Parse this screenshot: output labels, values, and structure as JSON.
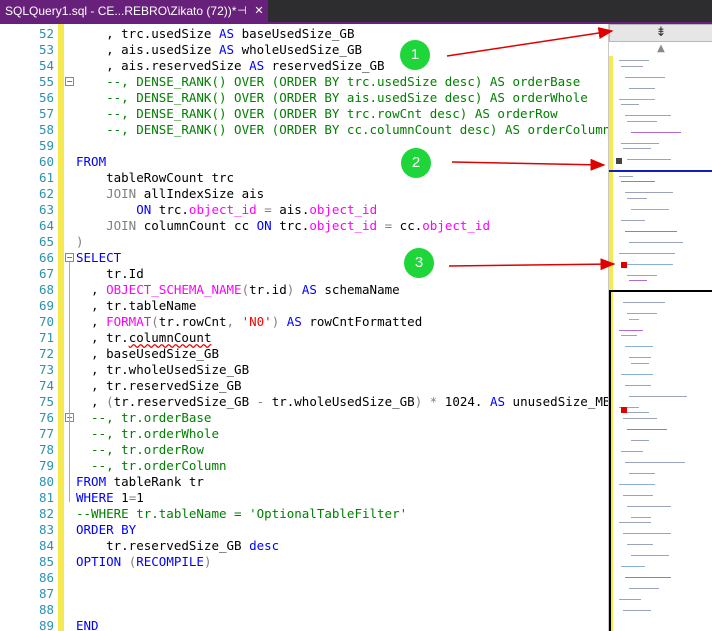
{
  "tab": {
    "title": "SQLQuery1.sql - CE...REBRO\\Zikato (72))*",
    "pin": "⊣",
    "close": "✕"
  },
  "scrollbar": {
    "split_glyph": "⇟",
    "up_glyph": "▲"
  },
  "annotations": [
    "1",
    "2",
    "3"
  ],
  "colors": {
    "tab": "#68217a",
    "keyword": "#0000ff",
    "function": "#ff00ff",
    "string": "#ff0000",
    "comment": "#008000",
    "changed_line": "#f5e94f",
    "marker": "#e00000"
  },
  "lines": [
    {
      "n": "52",
      "t": [
        [
          "",
          "    , trc.usedSize "
        ],
        [
          "kw",
          "AS"
        ],
        [
          "",
          " baseUsedSize_GB"
        ]
      ]
    },
    {
      "n": "53",
      "t": [
        [
          "",
          "    , ais.usedSize "
        ],
        [
          "kw",
          "AS"
        ],
        [
          "",
          " wholeUsedSize_GB"
        ]
      ]
    },
    {
      "n": "54",
      "t": [
        [
          "",
          "    , ais.reservedSize "
        ],
        [
          "kw",
          "AS"
        ],
        [
          "",
          " reservedSize_GB"
        ]
      ]
    },
    {
      "n": "55",
      "fold": true,
      "t": [
        [
          "cm",
          "    --, DENSE_RANK() OVER (ORDER BY trc.usedSize desc) AS orderBase"
        ]
      ]
    },
    {
      "n": "56",
      "t": [
        [
          "cm",
          "    --, DENSE_RANK() OVER (ORDER BY ais.usedSize desc) AS orderWhole"
        ]
      ]
    },
    {
      "n": "57",
      "t": [
        [
          "cm",
          "    --, DENSE_RANK() OVER (ORDER BY trc.rowCnt desc) AS orderRow"
        ]
      ]
    },
    {
      "n": "58",
      "t": [
        [
          "cm",
          "    --, DENSE_RANK() OVER (ORDER BY cc.columnCount desc) AS orderColumn"
        ]
      ]
    },
    {
      "n": "59",
      "t": []
    },
    {
      "n": "60",
      "t": [
        [
          "kw",
          "FROM"
        ]
      ]
    },
    {
      "n": "61",
      "t": [
        [
          "",
          "    tableRowCount trc"
        ]
      ]
    },
    {
      "n": "62",
      "t": [
        [
          "gr",
          "    "
        ],
        [
          "gr",
          "JOIN"
        ],
        [
          "",
          " allIndexSize ais"
        ]
      ]
    },
    {
      "n": "63",
      "t": [
        [
          "",
          "        "
        ],
        [
          "kw",
          "ON"
        ],
        [
          "",
          " trc."
        ],
        [
          "fn",
          "object_id"
        ],
        [
          "",
          " "
        ],
        [
          "gr",
          "="
        ],
        [
          "",
          " ais."
        ],
        [
          "fn",
          "object_id"
        ]
      ]
    },
    {
      "n": "64",
      "t": [
        [
          "",
          "    "
        ],
        [
          "gr",
          "JOIN"
        ],
        [
          "",
          " columnCount cc "
        ],
        [
          "kw",
          "ON"
        ],
        [
          "",
          " trc."
        ],
        [
          "fn",
          "object_id"
        ],
        [
          "",
          " "
        ],
        [
          "gr",
          "="
        ],
        [
          "",
          " cc."
        ],
        [
          "fn",
          "object_id"
        ]
      ]
    },
    {
      "n": "65",
      "t": [
        [
          "gr",
          ")"
        ]
      ]
    },
    {
      "n": "66",
      "fold": true,
      "t": [
        [
          "kw",
          "SELECT"
        ]
      ]
    },
    {
      "n": "67",
      "t": [
        [
          "",
          "    tr.Id"
        ]
      ]
    },
    {
      "n": "68",
      "t": [
        [
          "",
          "  , "
        ],
        [
          "fn",
          "OBJECT_SCHEMA_NAME"
        ],
        [
          "gr",
          "("
        ],
        [
          "",
          "tr.id"
        ],
        [
          "gr",
          ")"
        ],
        [
          "",
          " "
        ],
        [
          "kw",
          "AS"
        ],
        [
          "",
          " schemaName"
        ]
      ]
    },
    {
      "n": "69",
      "t": [
        [
          "",
          "  , tr.tableName"
        ]
      ]
    },
    {
      "n": "70",
      "t": [
        [
          "",
          "  , "
        ],
        [
          "fn",
          "FORMAT"
        ],
        [
          "gr",
          "("
        ],
        [
          "",
          "tr.rowCnt"
        ],
        [
          "gr",
          ","
        ],
        [
          "",
          " "
        ],
        [
          "str",
          "'N0'"
        ],
        [
          "gr",
          ")"
        ],
        [
          "",
          " "
        ],
        [
          "kw",
          "AS"
        ],
        [
          "",
          " rowCntFormatted"
        ]
      ]
    },
    {
      "n": "71",
      "t": [
        [
          "",
          "  , tr."
        ],
        [
          "sq",
          "columnCount"
        ]
      ]
    },
    {
      "n": "72",
      "t": [
        [
          "",
          "  , baseUsedSize_GB"
        ]
      ]
    },
    {
      "n": "73",
      "t": [
        [
          "",
          "  , tr.wholeUsedSize_GB"
        ]
      ]
    },
    {
      "n": "74",
      "t": [
        [
          "",
          "  , tr.reservedSize_GB"
        ]
      ]
    },
    {
      "n": "75",
      "t": [
        [
          "",
          "  , "
        ],
        [
          "gr",
          "("
        ],
        [
          "",
          "tr.reservedSize_GB "
        ],
        [
          "gr",
          "-"
        ],
        [
          "",
          " tr.wholeUsedSize_GB"
        ],
        [
          "gr",
          ")"
        ],
        [
          "",
          " "
        ],
        [
          "gr",
          "*"
        ],
        [
          "",
          " 1024. "
        ],
        [
          "kw",
          "AS"
        ],
        [
          "",
          " unusedSize_MB"
        ]
      ]
    },
    {
      "n": "76",
      "fold": true,
      "t": [
        [
          "cm",
          "  --, tr.orderBase"
        ]
      ]
    },
    {
      "n": "77",
      "t": [
        [
          "cm",
          "  --, tr.orderWhole"
        ]
      ]
    },
    {
      "n": "78",
      "t": [
        [
          "cm",
          "  --, tr.orderRow"
        ]
      ]
    },
    {
      "n": "79",
      "t": [
        [
          "cm",
          "  --, tr.orderColumn"
        ]
      ]
    },
    {
      "n": "80",
      "t": [
        [
          "kw",
          "FROM"
        ],
        [
          "",
          " tableRank tr"
        ]
      ]
    },
    {
      "n": "81",
      "t": [
        [
          "kw",
          "WHERE"
        ],
        [
          "",
          " 1"
        ],
        [
          "gr",
          "="
        ],
        [
          "",
          "1"
        ]
      ]
    },
    {
      "n": "82",
      "t": [
        [
          "cm",
          "--WHERE tr.tableName = 'OptionalTableFilter'"
        ]
      ]
    },
    {
      "n": "83",
      "t": [
        [
          "kw",
          "ORDER BY"
        ]
      ]
    },
    {
      "n": "84",
      "t": [
        [
          "",
          "    tr.reservedSize_GB "
        ],
        [
          "kw",
          "desc"
        ]
      ]
    },
    {
      "n": "85",
      "t": [
        [
          "kw",
          "OPTION"
        ],
        [
          "",
          " "
        ],
        [
          "gr",
          "("
        ],
        [
          "kw",
          "RECOMPILE"
        ],
        [
          "gr",
          ")"
        ]
      ]
    },
    {
      "n": "86",
      "t": []
    },
    {
      "n": "87",
      "t": []
    },
    {
      "n": "88",
      "t": []
    },
    {
      "n": "89",
      "t": [
        [
          "kw",
          "END"
        ]
      ]
    }
  ]
}
